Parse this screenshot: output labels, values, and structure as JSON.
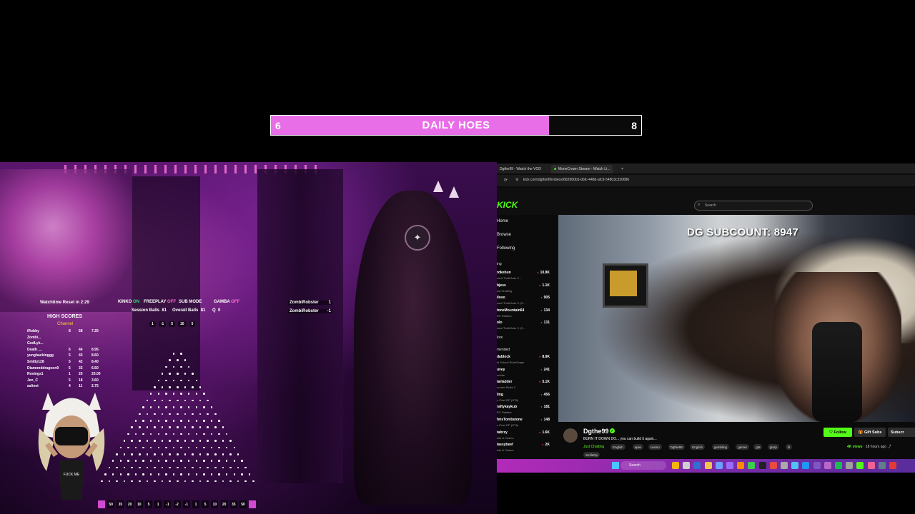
{
  "goal": {
    "title": "DAILY HOES",
    "start": "6",
    "end": "8",
    "progress": 0.75,
    "fill_color": "#e86ee8"
  },
  "stream_hud": {
    "watchtime": "Watchtime Reset in 2:29",
    "kinko": "KINKO",
    "kinko_state": "ON",
    "freeplay": "FREEPLAY",
    "freeplay_state": "OFF",
    "sub_mode": "SUB MODE",
    "gamba": "GAMBA",
    "gamba_state": "OFF",
    "session_balls_label": "Session Balls",
    "session_balls": "81",
    "overall_balls_label": "Overall Balls",
    "overall_balls": "81",
    "q_label": "Q",
    "q_value": "0",
    "bet_chips": [
      "1",
      "-1",
      "5",
      "10",
      "5"
    ],
    "zombie_rows": [
      {
        "name": "ZombiRobster",
        "value": "1"
      },
      {
        "name": "ZombiRobster",
        "value": "-1"
      }
    ]
  },
  "high_scores": {
    "title": "HIGH SCORES",
    "subtitle": "Channel",
    "rows": [
      {
        "name": "iRobby",
        "a": "8",
        "b": "58",
        "c": "7.25"
      },
      {
        "name": "Zombi...",
        "a": "",
        "b": "",
        "c": ""
      },
      {
        "name": "GodLyk...",
        "a": "",
        "b": "",
        "c": ""
      },
      {
        "name": "Death_...",
        "a": "6",
        "b": "44",
        "c": "8.95"
      },
      {
        "name": "yungbackinggg",
        "a": "5",
        "b": "43",
        "c": "8.60"
      },
      {
        "name": "Smitty128",
        "a": "5",
        "b": "42",
        "c": "8.40"
      },
      {
        "name": "Diamonddragoon9",
        "a": "5",
        "b": "33",
        "c": "6.60"
      },
      {
        "name": "Rovings1",
        "a": "1",
        "b": "20",
        "c": "20.00"
      },
      {
        "name": "Jen_C",
        "a": "5",
        "b": "18",
        "c": "3.60"
      },
      {
        "name": "aslinet",
        "a": "4",
        "b": "11",
        "c": "2.75"
      }
    ]
  },
  "plinko_buckets": [
    "",
    "50",
    "35",
    "20",
    "10",
    "5",
    "1",
    "-1",
    "-2",
    "-1",
    "1",
    "5",
    "10",
    "20",
    "35",
    "50",
    ""
  ],
  "avatar_shirt": "FUCK ME",
  "browser": {
    "tabs": [
      {
        "label": "Dgthe99 - Watch the VOD"
      },
      {
        "label": "MoneCrown Stream - Watch Li..."
      }
    ],
    "new_tab": "+",
    "url": "kick.com/dgthe99/videos/682960b5-dbfc-448d-afc9-54803c320686",
    "logo": "KICK",
    "search_placeholder": "Search",
    "nav": [
      {
        "label": "Home"
      },
      {
        "label": "Browse"
      },
      {
        "label": "Following"
      }
    ],
    "following_label": "ing",
    "following": [
      {
        "name": "rdkebun",
        "game": "rand Theft Auto V ...",
        "count": "10.8K"
      },
      {
        "name": "bjess",
        "game": "ust Chatting",
        "count": "1.1K"
      },
      {
        "name": "iloso",
        "game": "rand Theft Auto V (G...",
        "count": "905"
      },
      {
        "name": "toneMountain64",
        "game": "RC Raiders",
        "count": "134"
      },
      {
        "name": "olo",
        "game": "rand Theft Auto V (G...",
        "count": "131"
      }
    ],
    "more_label": "lore",
    "recommended_label": "mended",
    "recommended": [
      {
        "name": "dablock",
        "game": "ld School RuneScape",
        "count": "8.9K"
      },
      {
        "name": "uvey",
        "game": "ortnite",
        "count": "241"
      },
      {
        "name": "tarladder",
        "game": "ounter-Strike 2",
        "count": "5.1K"
      },
      {
        "name": "ling",
        "game": "o Pixel RP (GTA)",
        "count": "456"
      },
      {
        "name": "raftykaykub",
        "game": "RC Raiders",
        "count": "181"
      },
      {
        "name": "hrisTombstone",
        "game": "o Pixel RP (GTA)",
        "count": "148"
      },
      {
        "name": "tabrzy",
        "game": "lots & Casino",
        "count": "1.6K"
      },
      {
        "name": "lassybeef",
        "game": "lots & Casino",
        "count": "2K"
      }
    ],
    "video_overlay": "DG SUBCOUNT: 8947",
    "channel": {
      "name": "Dgthe99",
      "title": "BURN IT DOWN DO... you can build it again...",
      "category": "Just Chatting",
      "tags": [
        "English",
        "apex",
        "casino",
        "Dgthe99",
        "English",
        "gambling",
        "gamer",
        "gta",
        "gtarp",
        "irl",
        "SmileRp"
      ],
      "follow": "Follow",
      "gift": "Gift Subs",
      "subscribe": "Subscr",
      "views": "4K views",
      "time": "18 hours ago"
    }
  },
  "taskbar": {
    "search": "Search"
  }
}
